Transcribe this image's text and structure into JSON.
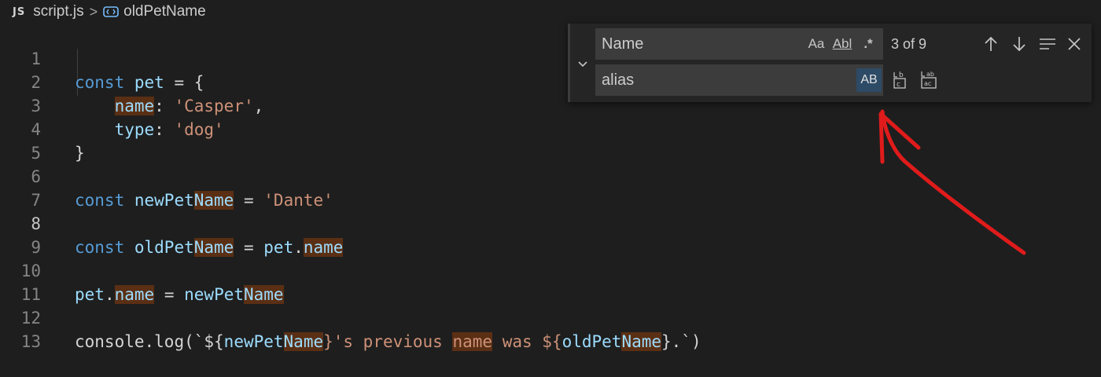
{
  "breadcrumb": {
    "file_badge": "JS",
    "file": "script.js",
    "separator": ">",
    "symbol": "oldPetName"
  },
  "editor": {
    "active_line": 8,
    "lines": [
      {
        "number": "1"
      },
      {
        "number": "2"
      },
      {
        "number": "3"
      },
      {
        "number": "4"
      },
      {
        "number": "5"
      },
      {
        "number": "6"
      },
      {
        "number": "7"
      },
      {
        "number": "8"
      },
      {
        "number": "9"
      },
      {
        "number": "10"
      },
      {
        "number": "11"
      },
      {
        "number": "12"
      },
      {
        "number": "13"
      }
    ],
    "code": {
      "l1": [
        "const",
        "pet",
        "=",
        "{"
      ],
      "l2": [
        "name",
        ":",
        "'Casper'",
        ","
      ],
      "l3": [
        "type",
        ":",
        "'dog'"
      ],
      "l4": [
        "}"
      ],
      "l6": [
        "const",
        "newPet",
        "Name",
        "=",
        "'Dante'"
      ],
      "l8": [
        "const",
        "oldPet",
        "Name",
        "=",
        "pet",
        ".",
        "name"
      ],
      "l10": [
        "pet",
        ".",
        "name",
        "=",
        "newPet",
        "Name"
      ],
      "l12": [
        "console",
        ".log(`${",
        "newPet",
        "Name",
        "}'s previous ",
        "name",
        " was ${",
        "oldPet",
        "Name",
        "}.`)"
      ]
    }
  },
  "find_widget": {
    "toggle_icon": "chevron-down-icon",
    "find_value": "Name",
    "match_case_label": "Aa",
    "whole_word_label": "Abl",
    "regex_label": ".*",
    "match_count": "3 of 9",
    "replace_value": "alias",
    "preserve_case_label": "AB",
    "icons": [
      "arrow-up-icon",
      "arrow-down-icon",
      "find-in-selection-icon",
      "close-icon",
      "replace-icon",
      "replace-all-icon"
    ]
  },
  "colors": {
    "background": "#1e1e1e",
    "keyword": "#569cd6",
    "identifier": "#9cdcfe",
    "string": "#ce9178",
    "match_highlight": "#5a2f14",
    "annotation": "#e01b1b"
  }
}
